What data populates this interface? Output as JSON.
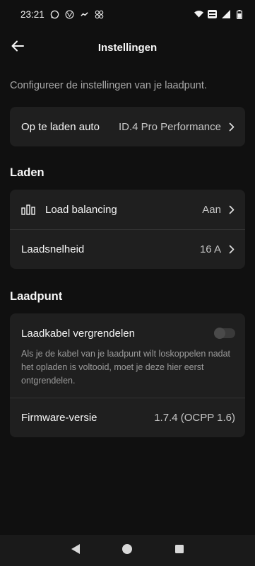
{
  "status": {
    "time": "23:21",
    "app_icons": [
      "whatsapp-icon",
      "volkswagen-icon",
      "signal-dot-icon",
      "pinwheel-icon"
    ],
    "right_icons": [
      "wifi-icon",
      "volte-icon",
      "cell-signal-icon",
      "battery-icon"
    ]
  },
  "header": {
    "title": "Instellingen",
    "back_icon": "arrow-left-icon"
  },
  "intro": "Configureer de instellingen van je laadpunt.",
  "car": {
    "label": "Op te laden auto",
    "value": "ID.4 Pro Performance"
  },
  "laden": {
    "heading": "Laden",
    "load_balancing": {
      "label": "Load balancing",
      "value": "Aan",
      "icon": "bar-chart-icon"
    },
    "speed": {
      "label": "Laadsnelheid",
      "value": "16 A"
    }
  },
  "laadpunt": {
    "heading": "Laadpunt",
    "lock": {
      "label": "Laadkabel vergrendelen",
      "enabled": false,
      "description": "Als je de kabel van je laadpunt wilt loskoppelen nadat het opladen is voltooid, moet je deze hier eerst ontgrendelen."
    },
    "firmware": {
      "label": "Firmware-versie",
      "value": "1.7.4 (OCPP 1.6)"
    }
  },
  "colors": {
    "background": "#101010",
    "card": "#1f1f1f",
    "muted_text": "#a9a9a9"
  }
}
